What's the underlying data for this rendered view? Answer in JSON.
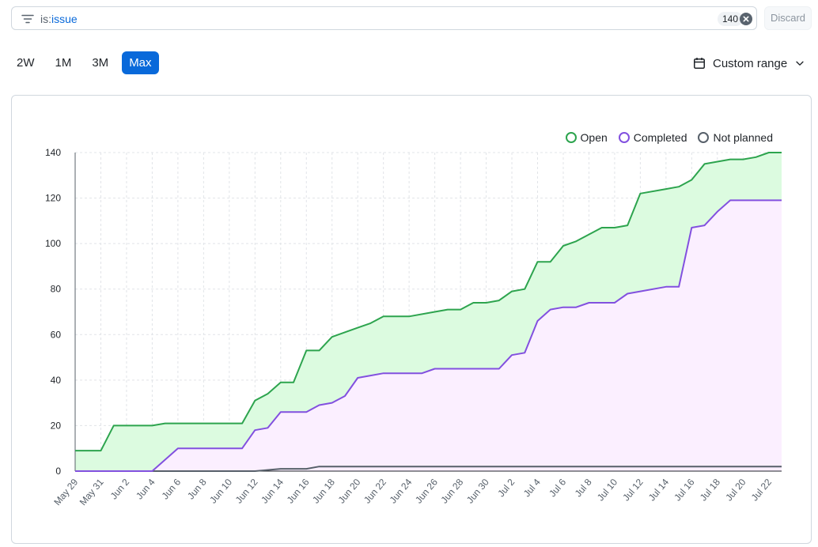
{
  "filter": {
    "query_key": "is:",
    "query_value": "issue",
    "count": "140",
    "discard_label": "Discard"
  },
  "range_buttons": [
    {
      "label": "2W",
      "active": false
    },
    {
      "label": "1M",
      "active": false
    },
    {
      "label": "3M",
      "active": false
    },
    {
      "label": "Max",
      "active": true
    }
  ],
  "custom_range_label": "Custom range",
  "colors": {
    "open_line": "#2da44e",
    "open_fill": "#dcfbe0",
    "completed_line": "#8250df",
    "completed_fill": "#fbefff",
    "not_planned_line": "#57606a",
    "accent": "#0969da"
  },
  "chart_data": {
    "type": "area",
    "title": "",
    "xlabel": "",
    "ylabel": "",
    "ylim": [
      0,
      140
    ],
    "yticks": [
      0,
      20,
      40,
      60,
      80,
      100,
      120,
      140
    ],
    "grid": true,
    "legend_position": "top-right",
    "x_start": "May 29",
    "x_end": "Jul 23",
    "x_tick_labels": [
      "May 29",
      "May 31",
      "Jun 2",
      "Jun 4",
      "Jun 6",
      "Jun 8",
      "Jun 10",
      "Jun 12",
      "Jun 14",
      "Jun 16",
      "Jun 18",
      "Jun 20",
      "Jun 22",
      "Jun 24",
      "Jun 26",
      "Jun 28",
      "Jun 30",
      "Jul 2",
      "Jul 4",
      "Jul 6",
      "Jul 8",
      "Jul 10",
      "Jul 12",
      "Jul 14",
      "Jul 16",
      "Jul 18",
      "Jul 20",
      "Jul 22"
    ],
    "series": [
      {
        "name": "Open",
        "points": [
          [
            "May 29",
            9
          ],
          [
            "May 31",
            9
          ],
          [
            "Jun 1",
            20
          ],
          [
            "Jun 3",
            20
          ],
          [
            "Jun 4",
            20
          ],
          [
            "Jun 5",
            21
          ],
          [
            "Jun 7",
            21
          ],
          [
            "Jun 9",
            21
          ],
          [
            "Jun 11",
            21
          ],
          [
            "Jun 12",
            31
          ],
          [
            "Jun 13",
            34
          ],
          [
            "Jun 14",
            39
          ],
          [
            "Jun 15",
            39
          ],
          [
            "Jun 16",
            53
          ],
          [
            "Jun 17",
            53
          ],
          [
            "Jun 18",
            59
          ],
          [
            "Jun 20",
            63
          ],
          [
            "Jun 21",
            65
          ],
          [
            "Jun 22",
            68
          ],
          [
            "Jun 24",
            68
          ],
          [
            "Jun 26",
            70
          ],
          [
            "Jun 27",
            71
          ],
          [
            "Jun 28",
            71
          ],
          [
            "Jun 29",
            74
          ],
          [
            "Jun 30",
            74
          ],
          [
            "Jul 1",
            75
          ],
          [
            "Jul 2",
            79
          ],
          [
            "Jul 3",
            80
          ],
          [
            "Jul 4",
            92
          ],
          [
            "Jul 5",
            92
          ],
          [
            "Jul 6",
            99
          ],
          [
            "Jul 7",
            101
          ],
          [
            "Jul 9",
            107
          ],
          [
            "Jul 10",
            107
          ],
          [
            "Jul 11",
            108
          ],
          [
            "Jul 12",
            122
          ],
          [
            "Jul 14",
            124
          ],
          [
            "Jul 15",
            125
          ],
          [
            "Jul 16",
            128
          ],
          [
            "Jul 17",
            135
          ],
          [
            "Jul 19",
            137
          ],
          [
            "Jul 20",
            137
          ],
          [
            "Jul 21",
            138
          ],
          [
            "Jul 22",
            140
          ],
          [
            "Jul 23",
            140
          ]
        ]
      },
      {
        "name": "Completed",
        "points": [
          [
            "May 29",
            0
          ],
          [
            "Jun 4",
            0
          ],
          [
            "Jun 6",
            10
          ],
          [
            "Jun 7",
            10
          ],
          [
            "Jun 9",
            10
          ],
          [
            "Jun 11",
            10
          ],
          [
            "Jun 12",
            18
          ],
          [
            "Jun 13",
            19
          ],
          [
            "Jun 14",
            26
          ],
          [
            "Jun 15",
            26
          ],
          [
            "Jun 16",
            26
          ],
          [
            "Jun 17",
            29
          ],
          [
            "Jun 18",
            30
          ],
          [
            "Jun 19",
            33
          ],
          [
            "Jun 20",
            41
          ],
          [
            "Jun 21",
            42
          ],
          [
            "Jun 22",
            43
          ],
          [
            "Jun 24",
            43
          ],
          [
            "Jun 25",
            43
          ],
          [
            "Jun 26",
            45
          ],
          [
            "Jun 28",
            45
          ],
          [
            "Jun 30",
            45
          ],
          [
            "Jul 1",
            45
          ],
          [
            "Jul 2",
            51
          ],
          [
            "Jul 3",
            52
          ],
          [
            "Jul 4",
            66
          ],
          [
            "Jul 5",
            71
          ],
          [
            "Jul 6",
            72
          ],
          [
            "Jul 7",
            72
          ],
          [
            "Jul 8",
            74
          ],
          [
            "Jul 9",
            74
          ],
          [
            "Jul 10",
            74
          ],
          [
            "Jul 11",
            78
          ],
          [
            "Jul 12",
            79
          ],
          [
            "Jul 14",
            81
          ],
          [
            "Jul 15",
            81
          ],
          [
            "Jul 16",
            107
          ],
          [
            "Jul 17",
            108
          ],
          [
            "Jul 18",
            114
          ],
          [
            "Jul 19",
            119
          ],
          [
            "Jul 20",
            119
          ],
          [
            "Jul 23",
            119
          ]
        ]
      },
      {
        "name": "Not planned",
        "points": [
          [
            "May 29",
            0
          ],
          [
            "Jun 12",
            0
          ],
          [
            "Jun 14",
            1
          ],
          [
            "Jun 16",
            1
          ],
          [
            "Jun 17",
            2
          ],
          [
            "Jul 23",
            2
          ]
        ]
      }
    ]
  }
}
